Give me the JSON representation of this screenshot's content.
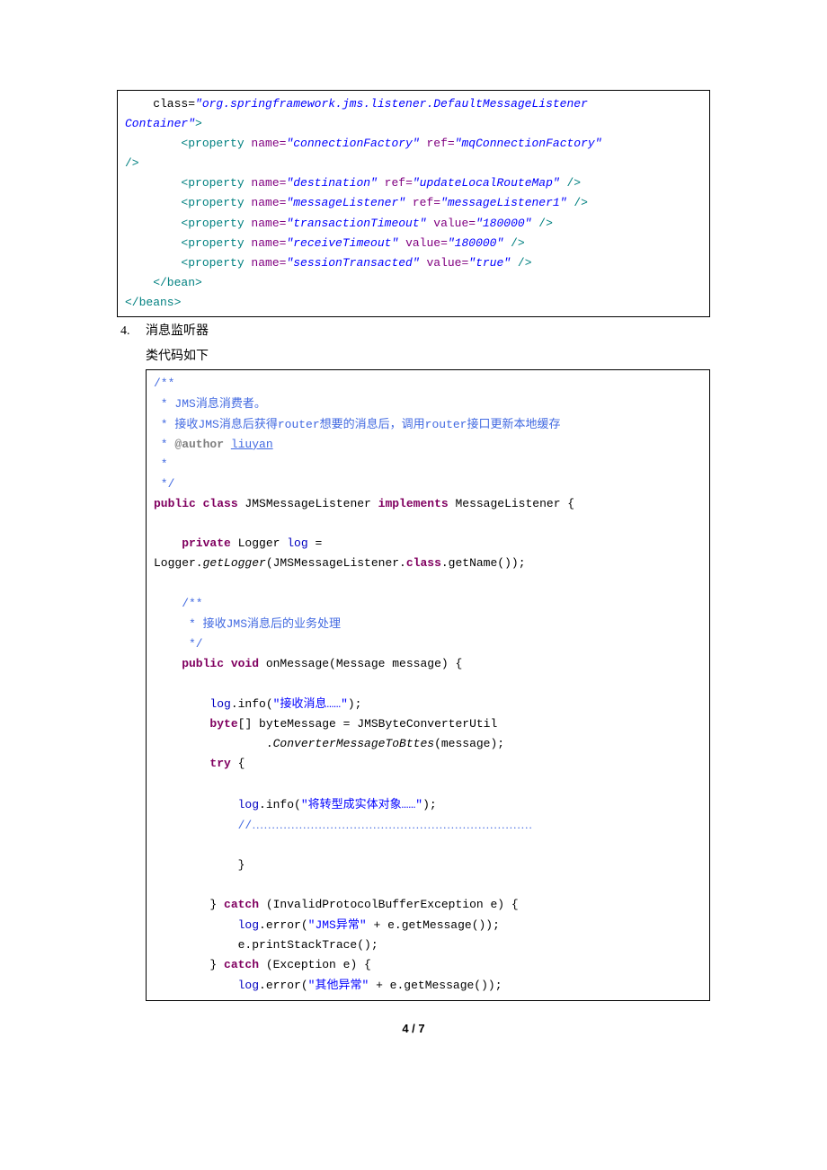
{
  "block1": {
    "l1a": "    class=",
    "l1v": "\"org.springframework.jms.listener.DefaultMessageListener",
    "l2v": "Container\"",
    "l2b": ">",
    "l3a": "        <property",
    "name_attr": " name=",
    "ref_attr": " ref=",
    "value_attr": " value=",
    "close_self": " />",
    "p1name": "\"connectionFactory\"",
    "p1ref": "\"mqConnectionFactory\"",
    "l4": "/>",
    "p2name": "\"destination\"",
    "p2ref": "\"updateLocalRouteMap\"",
    "p3name": "\"messageListener\"",
    "p3ref": "\"messageListener1\"",
    "p4name": "\"transactionTimeout\"",
    "p4val": "\"180000\"",
    "p5name": "\"receiveTimeout\"",
    "p5val": "\"180000\"",
    "p6name": "\"sessionTransacted\"",
    "p6val": "\"true\"",
    "end_bean": "    </bean>",
    "end_beans": "</beans>"
  },
  "section4": {
    "num": "4.",
    "title": "消息监听器",
    "sub": "类代码如下"
  },
  "block2": {
    "c1": "/**",
    "c2a": " * JMS",
    "c2b": "消息消费者。",
    "c3a": " * ",
    "c3b": "接收",
    "c3c": "JMS",
    "c3d": "消息后获得",
    "c3e": "router",
    "c3f": "想要的消息后，调用",
    "c3g": "router",
    "c3h": "接口更新本地缓存",
    "c4a": " * ",
    "c4b": "@author",
    "c4c": " ",
    "c4d": "liuyan",
    "c5": " *",
    "c6": " */",
    "l7a": "public",
    "l7b": " class",
    "l7c": " JMSMessageListener ",
    "l7d": "implements",
    "l7e": " MessageListener {",
    "l9a": "    private",
    "l9b": " Logger ",
    "l9c": "log",
    "l9d": " = ",
    "l10a": "Logger.",
    "l10b": "getLogger",
    "l10c": "(JMSMessageListener.",
    "l10d": "class",
    "l10e": ".getName());",
    "c11": "    /**",
    "c12a": "     * ",
    "c12b": "接收",
    "c12c": "JMS",
    "c12d": "消息后的业务处理",
    "c13": "     */",
    "l14a": "    public",
    "l14b": " void",
    "l14c": " onMessage(Message message) {",
    "l16a": "        ",
    "l16b": "log",
    "l16c": ".info(",
    "l16d": "\"",
    "l16e": "接收消息",
    "l16f": "……\"",
    "l16g": ");",
    "l17a": "        ",
    "l17b": "byte",
    "l17c": "[] byteMessage = JMSByteConverterUtil",
    "l18a": "                .",
    "l18b": "ConverterMessageToBttes",
    "l18c": "(message);",
    "l19a": "        ",
    "l19b": "try",
    "l19c": " {",
    "l21a": "            ",
    "l21b": "log",
    "l21c": ".info(",
    "l21d": "\"",
    "l21e": "将转型成实体对象",
    "l21f": "……\"",
    "l21g": ");",
    "l22a": "            //",
    "l22b": "………………………………………………………………",
    "l24": "            }",
    "l26a": "        } ",
    "l26b": "catch",
    "l26c": " (InvalidProtocolBufferException e) {",
    "l27a": "            ",
    "l27b": "log",
    "l27c": ".error(",
    "l27d": "\"JMS",
    "l27e": "异常",
    "l27f": "\"",
    "l27g": " + e.getMessage());",
    "l28": "            e.printStackTrace();",
    "l29a": "        } ",
    "l29b": "catch",
    "l29c": " (Exception e) {",
    "l30a": "            ",
    "l30b": "log",
    "l30c": ".error(",
    "l30d": "\"",
    "l30e": "其他异常",
    "l30f": "\"",
    "l30g": " + e.getMessage());"
  },
  "footer": "4 / 7"
}
